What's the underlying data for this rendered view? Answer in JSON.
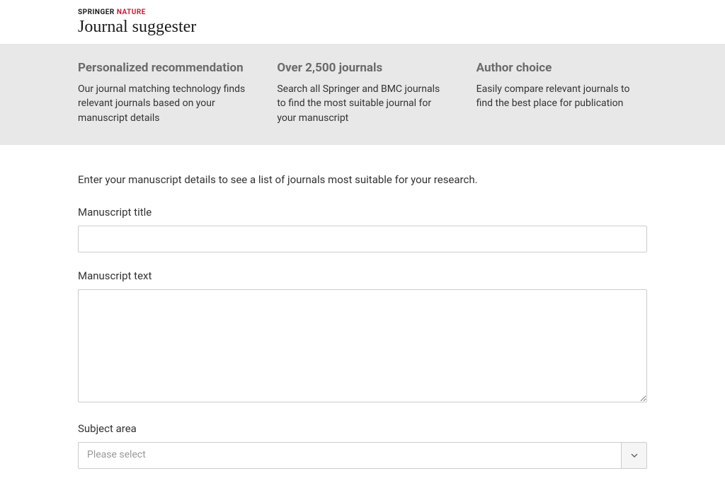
{
  "header": {
    "brand_part1": "SPRINGER",
    "brand_part2": "NATURE",
    "site_title": "Journal suggester"
  },
  "features": [
    {
      "title": "Personalized recommendation",
      "desc": "Our journal matching technology finds relevant journals based on your manuscript details"
    },
    {
      "title": "Over 2,500 journals",
      "desc": "Search all Springer and BMC journals to find the most suitable journal for your manuscript"
    },
    {
      "title": "Author choice",
      "desc": "Easily compare relevant journals to find the best place for publication"
    }
  ],
  "form": {
    "intro": "Enter your manuscript details to see a list of journals most suitable for your research.",
    "title_label": "Manuscript title",
    "title_value": "",
    "text_label": "Manuscript text",
    "text_value": "",
    "subject_label": "Subject area",
    "subject_placeholder": "Please select"
  }
}
